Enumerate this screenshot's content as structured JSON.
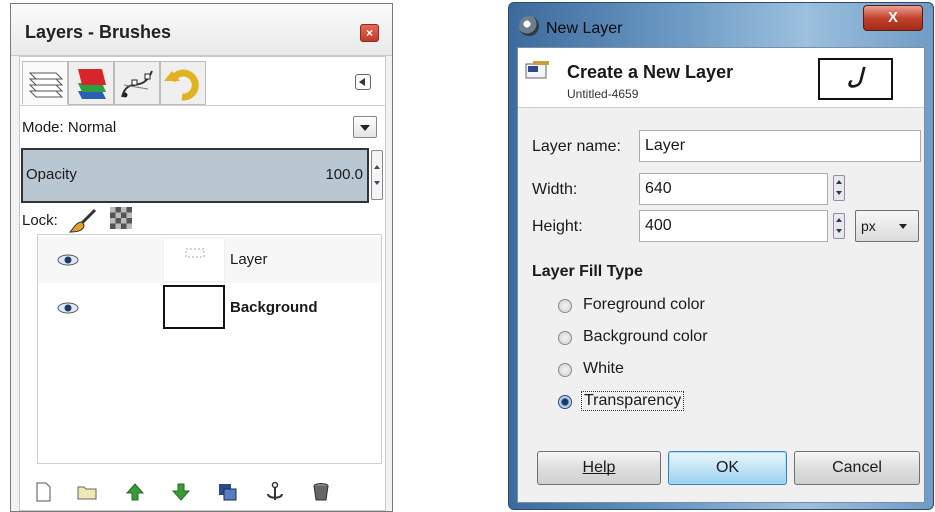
{
  "layers_panel": {
    "title": "Layers - Brushes",
    "close_label": "×",
    "tabs": [
      {
        "name": "layers-tab",
        "icon": "layers-icon"
      },
      {
        "name": "channels-tab",
        "icon": "channels-icon"
      },
      {
        "name": "paths-tab",
        "icon": "paths-icon"
      },
      {
        "name": "undo-history-tab",
        "icon": "undo-icon"
      }
    ],
    "mode_label": "Mode: Normal",
    "opacity_label": "Opacity",
    "opacity_value": "100.0",
    "lock_label": "Lock:",
    "layers": [
      {
        "name": "Layer",
        "visible": true
      },
      {
        "name": "Background",
        "visible": true
      }
    ],
    "toolbar": [
      "new-layer-icon",
      "new-layer-group-icon",
      "raise-layer-icon",
      "lower-layer-icon",
      "duplicate-layer-icon",
      "anchor-icon",
      "delete-layer-icon"
    ],
    "colors": {
      "opacity_bg": "#b9c7d3",
      "raise": "#3a9a3a",
      "lower": "#3a9a3a"
    }
  },
  "dialog": {
    "window_title": "New Layer",
    "close_label": "X",
    "heading": "Create a New Layer",
    "subheading": "Untitled-4659",
    "preview_glyph": "ل",
    "layer_name_label": "Layer name:",
    "layer_name_value": "Layer",
    "width_label": "Width:",
    "width_value": "640",
    "height_label": "Height:",
    "height_value": "400",
    "unit": "px",
    "fill_type_heading": "Layer Fill Type",
    "fill_options": [
      {
        "label": "Foreground color",
        "checked": false
      },
      {
        "label": "Background color",
        "checked": false
      },
      {
        "label": "White",
        "checked": false
      },
      {
        "label": "Transparency",
        "checked": true
      }
    ],
    "buttons": {
      "help": "Help",
      "ok": "OK",
      "cancel": "Cancel"
    },
    "colors": {
      "frame": "#6c9ac4",
      "ok_button": "#c4e5f6",
      "close_button": "#c3422d"
    }
  }
}
